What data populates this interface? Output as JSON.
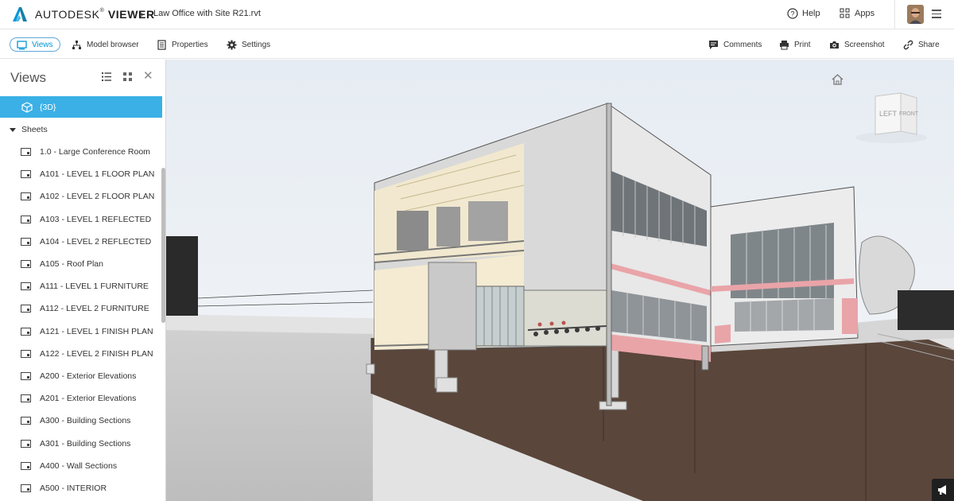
{
  "header": {
    "brand_main": "AUTODESK",
    "brand_tm": "®",
    "brand_product": "VIEWER",
    "file_name": "Law Office with Site R21.rvt",
    "help_label": "Help",
    "apps_label": "Apps"
  },
  "toolbar": {
    "views_label": "Views",
    "model_browser_label": "Model browser",
    "properties_label": "Properties",
    "settings_label": "Settings",
    "comments_label": "Comments",
    "print_label": "Print",
    "screenshot_label": "Screenshot",
    "share_label": "Share"
  },
  "sidebar": {
    "title": "Views",
    "selected_view": "{3D}",
    "sheets_label": "Sheets",
    "sheets": [
      "1.0 - Large Conference Room",
      "A101 - LEVEL 1 FLOOR PLAN",
      "A102 - LEVEL 2 FLOOR PLAN",
      "A103 - LEVEL 1 REFLECTED",
      "A104 - LEVEL 2 REFLECTED",
      "A105 - Roof Plan",
      "A111 - LEVEL 1 FURNITURE",
      "A112 - LEVEL 2 FURNITURE",
      "A121 - LEVEL 1 FINISH PLAN",
      "A122 - LEVEL 2 FINISH PLAN",
      "A200 - Exterior Elevations",
      "A201 - Exterior Elevations",
      "A300 - Building Sections",
      "A301 - Building Sections",
      "A400 - Wall Sections",
      "A500 - INTERIOR"
    ]
  },
  "viewcube": {
    "left_label": "LEFT",
    "front_label": "FRONT"
  },
  "colors": {
    "accent": "#0696d7",
    "selected_row": "#3ab0e6",
    "soil": "#5a463b",
    "wall": "#e8e8e8",
    "accent_band": "#e9a4a8"
  }
}
